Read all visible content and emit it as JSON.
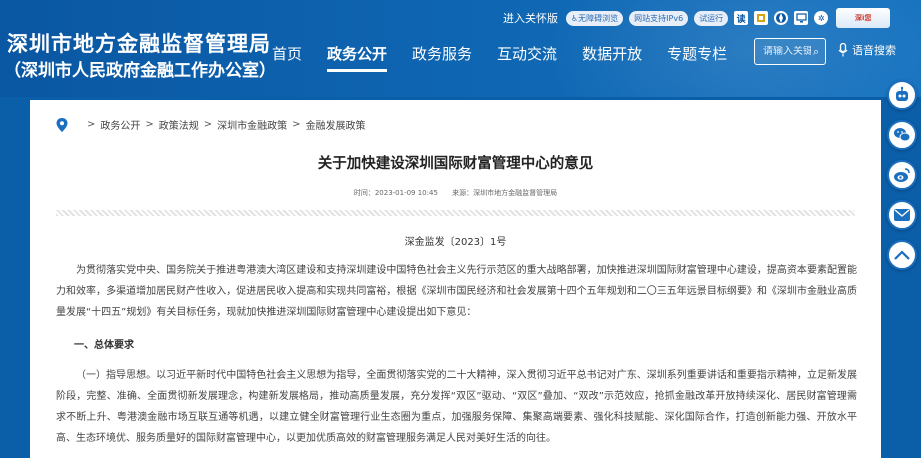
{
  "header": {
    "site_title": "深圳市地方金融监督管理局",
    "site_subtitle": "（深圳市人民政府金融工作办公室）",
    "top_links": {
      "care_mode": "进入关怀版",
      "accessibility": "无障碍浏览",
      "ipv6": "网站支持IPv6",
      "trial": "试运行",
      "icon_letter": "读",
      "badge_text": "深i您"
    },
    "nav": [
      "首页",
      "政务公开",
      "政务服务",
      "互动交流",
      "数据开放",
      "专题专栏"
    ],
    "active_nav": "政务公开",
    "search": {
      "placeholder": "请输入关键"
    },
    "voice_search": "语音搜索"
  },
  "breadcrumb": [
    "政务公开",
    "政策法规",
    "深圳市金融政策",
    "金融发展政策"
  ],
  "article": {
    "title": "关于加快建设深圳国际财富管理中心的意见",
    "time": "时间：2023-01-09 10:45",
    "source": "来源：深圳市地方金融监督管理局",
    "doc_number": "深金监发〔2023〕1号",
    "intro": "为贯彻落实党中央、国务院关于推进粤港澳大湾区建设和支持深圳建设中国特色社会主义先行示范区的重大战略部署，加快推进深圳国际财富管理中心建设，提高资本要素配置能力和效率，多渠道增加居民财产性收入，促进居民收入提高和实现共同富裕，根据《深圳市国民经济和社会发展第十四个五年规划和二〇三五年远景目标纲要》和《深圳市金融业高质量发展“十四五”规划》有关目标任务，现就加快推进深圳国际财富管理中心建设提出如下意见：",
    "section1_heading": "一、总体要求",
    "section1_para": "（一）指导思想。以习近平新时代中国特色社会主义思想为指导，全面贯彻落实党的二十大精神，深入贯彻习近平总书记对广东、深圳系列重要讲话和重要指示精神，立足新发展阶段，完整、准确、全面贯彻新发展理念，构建新发展格局，推动高质量发展，充分发挥“双区”驱动、“双区”叠加、“双改”示范效应，抢抓金融改革开放持续深化、居民财富管理需求不断上升、粤港澳金融市场互联互通等机遇，以建立健全财富管理行业生态圈为重点，加强服务保障、集聚高端要素、强化科技赋能、深化国际合作，打造创新能力强、开放水平高、生态环境优、服务质量好的国际财富管理中心，以更加优质高效的财富管理服务满足人民对美好生活的向往。"
  },
  "colors": {
    "brand": "#0b5ea8",
    "side_border": "#1a6fbf"
  },
  "side_icons": [
    "robot-icon",
    "wechat-icon",
    "weibo-icon",
    "mail-icon",
    "back-to-top-icon"
  ]
}
